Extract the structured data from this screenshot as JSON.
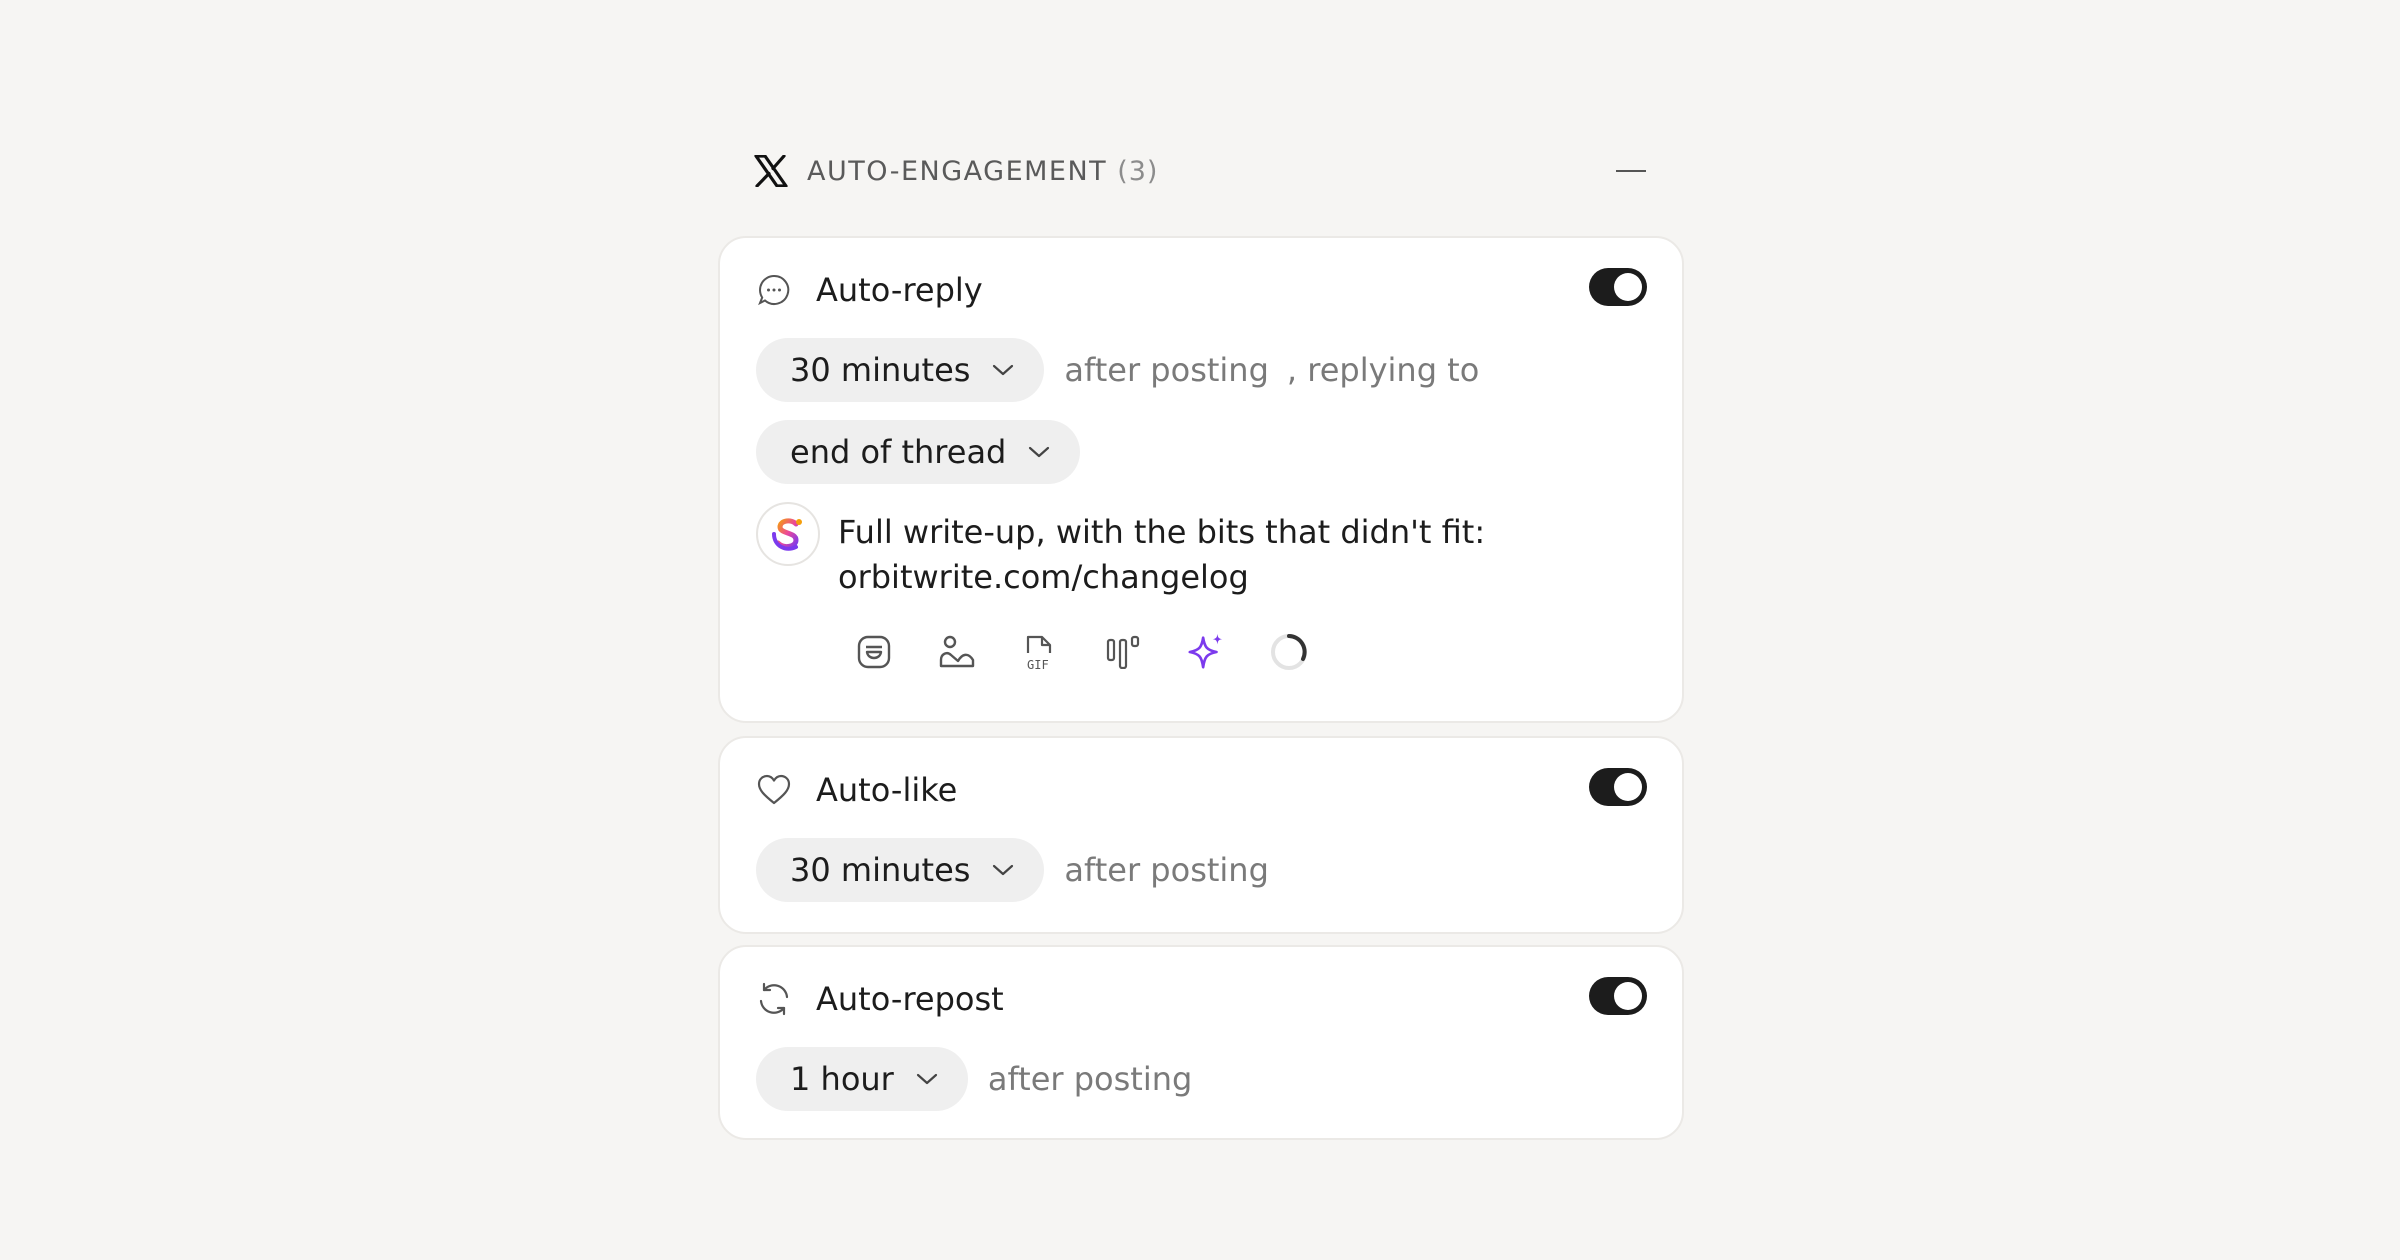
{
  "header": {
    "title": "AUTO-ENGAGEMENT",
    "count": "(3)"
  },
  "auto_reply": {
    "label": "Auto-reply",
    "enabled": true,
    "delay": "30 minutes",
    "after_text": "after posting",
    "replying_text": ", replying to",
    "target": "end of thread",
    "message_line1": "Full write-up, with the bits that didn't fit:",
    "message_line2": "orbitwrite.com/changelog",
    "tools": [
      "emoji-icon",
      "image-icon",
      "gif-icon",
      "poll-icon",
      "ai-sparkle-icon",
      "character-count-icon"
    ]
  },
  "auto_like": {
    "label": "Auto-like",
    "enabled": true,
    "delay": "30 minutes",
    "after_text": "after posting"
  },
  "auto_repost": {
    "label": "Auto-repost",
    "enabled": true,
    "delay": "1 hour",
    "after_text": "after posting"
  },
  "colors": {
    "background": "#f6f5f3",
    "card": "#ffffff",
    "toggle_on": "#1c1c1c",
    "pill": "#efefef",
    "accent_purple": "#7c3aed"
  }
}
